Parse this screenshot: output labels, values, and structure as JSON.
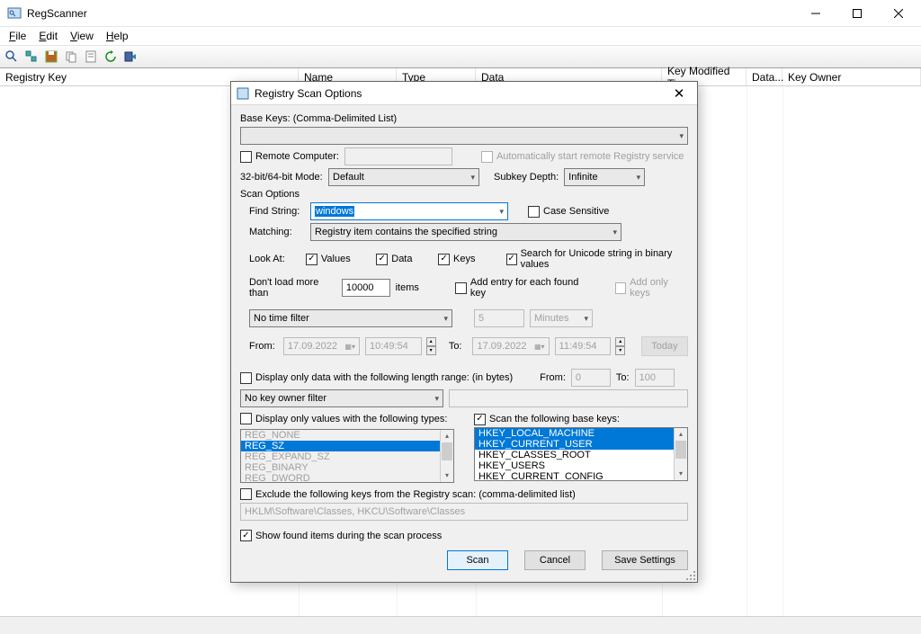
{
  "window": {
    "title": "RegScanner",
    "menus": [
      "File",
      "Edit",
      "View",
      "Help"
    ]
  },
  "columns": [
    "Registry Key",
    "Name",
    "Type",
    "Data",
    "Key Modified Time",
    "Data...",
    "Key Owner"
  ],
  "dialog": {
    "title": "Registry Scan Options",
    "base_keys_label": "Base Keys:   (Comma-Delimited List)",
    "remote_computer": "Remote Computer:",
    "auto_start_remote": "Automatically start remote Registry service",
    "mode_label": "32-bit/64-bit Mode:",
    "mode_value": "Default",
    "subkey_depth_label": "Subkey Depth:",
    "subkey_depth_value": "Infinite",
    "scan_options": "Scan Options",
    "find_string_label": "Find String:",
    "find_string_value": "windows",
    "case_sensitive": "Case Sensitive",
    "matching_label": "Matching:",
    "matching_value": "Registry item contains the specified string",
    "look_at": "Look At:",
    "values": "Values",
    "data": "Data",
    "keys": "Keys",
    "unicode": "Search for Unicode string in binary values",
    "dont_load": "Don't load more than",
    "dont_load_value": "10000",
    "items": "items",
    "add_entry": "Add entry for each found key",
    "add_only_keys": "Add only keys",
    "time_filter": "No time filter",
    "time_amount": "5",
    "time_unit": "Minutes",
    "from": "From:",
    "to": "To:",
    "date1": "17.09.2022",
    "time1": "10:49:54",
    "date2": "17.09.2022",
    "time2": "11:49:54",
    "today": "Today",
    "display_length": "Display only data with the following length range: (in bytes)",
    "length_from": "0",
    "length_to": "100",
    "key_owner_filter": "No key owner filter",
    "display_types": "Display only values with the following types:",
    "scan_base_keys": "Scan the following base keys:",
    "reg_types": [
      "REG_NONE",
      "REG_SZ",
      "REG_EXPAND_SZ",
      "REG_BINARY",
      "REG_DWORD"
    ],
    "hkeys": [
      "HKEY_LOCAL_MACHINE",
      "HKEY_CURRENT_USER",
      "HKEY_CLASSES_ROOT",
      "HKEY_USERS",
      "HKEY_CURRENT_CONFIG"
    ],
    "exclude_label": "Exclude the following keys from the Registry scan: (comma-delimited list)",
    "exclude_value": "HKLM\\Software\\Classes, HKCU\\Software\\Classes",
    "show_found": "Show found items during the scan process",
    "scan_btn": "Scan",
    "cancel_btn": "Cancel",
    "save_btn": "Save Settings"
  }
}
